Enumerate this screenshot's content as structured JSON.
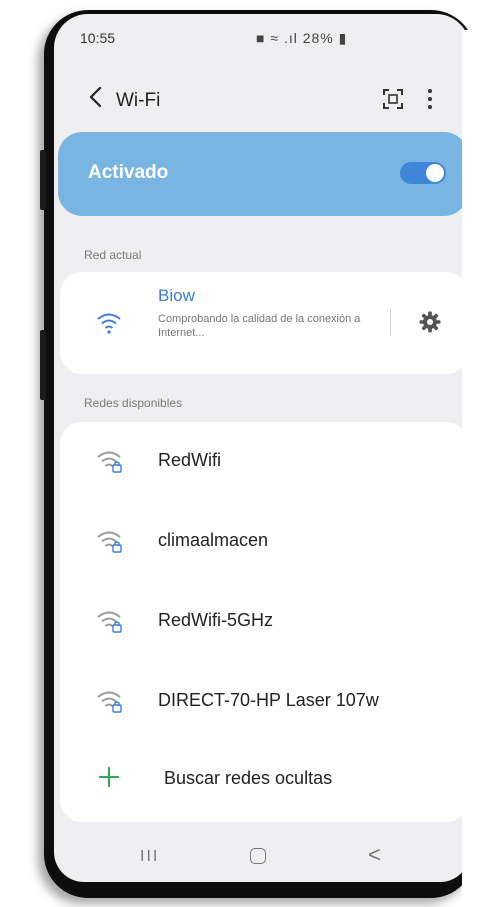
{
  "status_bar": {
    "time": "10:55",
    "indicators": "28%"
  },
  "app_bar": {
    "title": "Wi-Fi"
  },
  "toggle": {
    "label": "Activado",
    "on": true
  },
  "current_section": {
    "title": "Red actual"
  },
  "current_network": {
    "name": "Biow",
    "status": "Comprobando la calidad de la conexión a Internet..."
  },
  "available_section": {
    "title": "Redes disponibles"
  },
  "networks": [
    {
      "name": "RedWifi",
      "secured": true
    },
    {
      "name": "climaalmacen",
      "secured": true
    },
    {
      "name": "RedWifi-5GHz",
      "secured": true
    },
    {
      "name": "DIRECT-70-HP Laser 107w",
      "secured": true
    }
  ],
  "hidden_networks": {
    "label": "Buscar redes ocultas"
  },
  "nav_bar": {
    "recent_label": "III",
    "back_label": "<"
  },
  "colors": {
    "accent": "#3b7dd8",
    "toggle_card": "#79b5e2",
    "plus": "#3da35d"
  }
}
